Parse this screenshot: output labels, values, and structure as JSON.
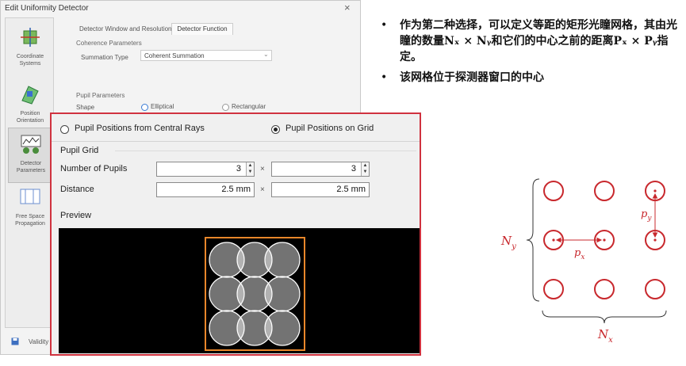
{
  "background_dialog": {
    "title": "Edit Uniformity Detector",
    "close": "×",
    "sidebar": [
      {
        "label1": "Coordinate",
        "label2": "Systems"
      },
      {
        "label1": "Position",
        "label2": "Orientation"
      },
      {
        "label1": "Detector",
        "label2": "Parameters"
      },
      {
        "label1": "Free Space",
        "label2": "Propagation"
      }
    ],
    "tabs": [
      "Detector Window and Resolution",
      "Detector Function"
    ],
    "coherence_header": "Coherence Parameters",
    "summation_label": "Summation Type",
    "summation_value": "Coherent Summation",
    "pupil_header": "Pupil Parameters",
    "shape_label": "Shape",
    "shape_options": [
      "Elliptical",
      "Rectangular"
    ],
    "validity_label": "Validity"
  },
  "panel": {
    "option_central": "Pupil Positions from Central Rays",
    "option_grid": "Pupil Positions on Grid",
    "selected": "Pupil Positions on Grid",
    "grid_header": "Pupil Grid",
    "num_label": "Number of Pupils",
    "num_x": "3",
    "num_y": "3",
    "dist_label": "Distance",
    "dist_x": "2.5 mm",
    "dist_y": "2.5 mm",
    "times": "×",
    "preview_label": "Preview"
  },
  "bullets": [
    {
      "dot": "•",
      "text": "作为第二种选择，可以定义等距的矩形光瞳网格，其由光瞳的数量Nₓ × Nᵧ和它们的中心之前的距离Pₓ × Pᵧ指定。"
    },
    {
      "dot": "•",
      "text": "该网格位于探测器窗口的中心"
    }
  ],
  "diagram": {
    "ny": "N",
    "ny_sub": "y",
    "nx": "N",
    "nx_sub": "x",
    "px": "p",
    "px_sub": "x",
    "py": "p",
    "py_sub": "y",
    "color": "#c8282d"
  },
  "colors": {
    "accent_red": "#d0323f",
    "preview_box": "#e8862a"
  }
}
